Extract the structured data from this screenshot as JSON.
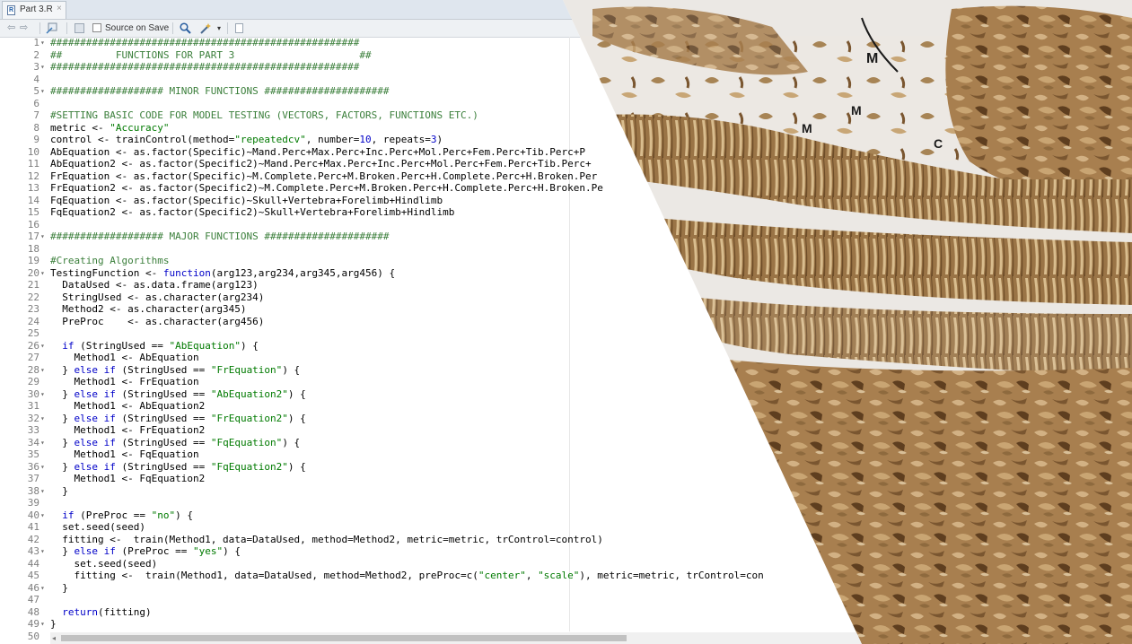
{
  "tab": {
    "icon": "R",
    "label": "Part 3.R",
    "close": "×"
  },
  "toolbar": {
    "source_on_save": "Source on Save",
    "back_arrow": "⇦",
    "forward_arrow": "⇨"
  },
  "colors": {
    "tab_bar": "#dfe6ee",
    "toolbar": "#eef1f4",
    "comment": "#3b7f3b",
    "string": "#007a00",
    "keyword": "#0000c8",
    "line_number": "#7e7e7e"
  },
  "photo": {
    "subject": "sorted bones and teeth fragments",
    "marker_letters": [
      "M",
      "M",
      "M",
      "C"
    ]
  },
  "code_lines": [
    {
      "n": "1",
      "fold": true,
      "segs": [
        {
          "t": "####################################################",
          "c": "cm"
        }
      ]
    },
    {
      "n": "2",
      "fold": false,
      "segs": [
        {
          "t": "##         FUNCTIONS FOR PART 3                     ##",
          "c": "cm"
        }
      ]
    },
    {
      "n": "3",
      "fold": true,
      "segs": [
        {
          "t": "####################################################",
          "c": "cm"
        }
      ]
    },
    {
      "n": "4",
      "fold": false,
      "segs": []
    },
    {
      "n": "5",
      "fold": true,
      "segs": [
        {
          "t": "################### MINOR FUNCTIONS #####################",
          "c": "cm"
        }
      ]
    },
    {
      "n": "6",
      "fold": false,
      "segs": []
    },
    {
      "n": "7",
      "fold": false,
      "segs": [
        {
          "t": "#SETTING BASIC CODE FOR MODEL TESTING (VECTORS, FACTORS, FUNCTIONS ETC.)",
          "c": "cm"
        }
      ]
    },
    {
      "n": "8",
      "fold": false,
      "segs": [
        {
          "t": "metric <- ",
          "c": ""
        },
        {
          "t": "\"Accuracy\"",
          "c": "st"
        }
      ]
    },
    {
      "n": "9",
      "fold": false,
      "segs": [
        {
          "t": "control <- trainControl(method=",
          "c": ""
        },
        {
          "t": "\"repeatedcv\"",
          "c": "st"
        },
        {
          "t": ", number=",
          "c": ""
        },
        {
          "t": "10",
          "c": "nm"
        },
        {
          "t": ", repeats=",
          "c": ""
        },
        {
          "t": "3",
          "c": "nm"
        },
        {
          "t": ")",
          "c": ""
        }
      ]
    },
    {
      "n": "10",
      "fold": false,
      "segs": [
        {
          "t": "AbEquation <- as.factor(Specific)~Mand.Perc+Max.Perc+Inc.Perc+Mol.Perc+Fem.Perc+Tib.Perc+P",
          "c": ""
        }
      ]
    },
    {
      "n": "11",
      "fold": false,
      "segs": [
        {
          "t": "AbEquation2 <- as.factor(Specific2)~Mand.Perc+Max.Perc+Inc.Perc+Mol.Perc+Fem.Perc+Tib.Perc+",
          "c": ""
        }
      ]
    },
    {
      "n": "12",
      "fold": false,
      "segs": [
        {
          "t": "FrEquation <- as.factor(Specific)~M.Complete.Perc+M.Broken.Perc+H.Complete.Perc+H.Broken.Per",
          "c": ""
        }
      ]
    },
    {
      "n": "13",
      "fold": false,
      "segs": [
        {
          "t": "FrEquation2 <- as.factor(Specific2)~M.Complete.Perc+M.Broken.Perc+H.Complete.Perc+H.Broken.Pe",
          "c": ""
        }
      ]
    },
    {
      "n": "14",
      "fold": false,
      "segs": [
        {
          "t": "FqEquation <- as.factor(Specific)~Skull+Vertebra+Forelimb+Hindlimb",
          "c": ""
        }
      ]
    },
    {
      "n": "15",
      "fold": false,
      "segs": [
        {
          "t": "FqEquation2 <- as.factor(Specific2)~Skull+Vertebra+Forelimb+Hindlimb",
          "c": ""
        }
      ]
    },
    {
      "n": "16",
      "fold": false,
      "segs": []
    },
    {
      "n": "17",
      "fold": true,
      "segs": [
        {
          "t": "################### MAJOR FUNCTIONS #####################",
          "c": "cm"
        }
      ]
    },
    {
      "n": "18",
      "fold": false,
      "segs": []
    },
    {
      "n": "19",
      "fold": false,
      "segs": [
        {
          "t": "#Creating Algorithms",
          "c": "cm"
        }
      ]
    },
    {
      "n": "20",
      "fold": true,
      "segs": [
        {
          "t": "TestingFunction <- ",
          "c": ""
        },
        {
          "t": "function",
          "c": "kw"
        },
        {
          "t": "(arg123,arg234,arg345,arg456) {",
          "c": ""
        }
      ]
    },
    {
      "n": "21",
      "fold": false,
      "segs": [
        {
          "t": "  DataUsed <- as.data.frame(arg123)",
          "c": ""
        }
      ]
    },
    {
      "n": "22",
      "fold": false,
      "segs": [
        {
          "t": "  StringUsed <- as.character(arg234)",
          "c": ""
        }
      ]
    },
    {
      "n": "23",
      "fold": false,
      "segs": [
        {
          "t": "  Method2 <- as.character(arg345)",
          "c": ""
        }
      ]
    },
    {
      "n": "24",
      "fold": false,
      "segs": [
        {
          "t": "  PreProc    <- as.character(arg456)",
          "c": ""
        }
      ]
    },
    {
      "n": "25",
      "fold": false,
      "segs": []
    },
    {
      "n": "26",
      "fold": true,
      "segs": [
        {
          "t": "  ",
          "c": ""
        },
        {
          "t": "if",
          "c": "kw"
        },
        {
          "t": " (StringUsed == ",
          "c": ""
        },
        {
          "t": "\"AbEquation\"",
          "c": "st"
        },
        {
          "t": ") {",
          "c": ""
        }
      ]
    },
    {
      "n": "27",
      "fold": false,
      "segs": [
        {
          "t": "    Method1 <- AbEquation",
          "c": ""
        }
      ]
    },
    {
      "n": "28",
      "fold": true,
      "segs": [
        {
          "t": "  } ",
          "c": ""
        },
        {
          "t": "else if",
          "c": "kw"
        },
        {
          "t": " (StringUsed == ",
          "c": ""
        },
        {
          "t": "\"FrEquation\"",
          "c": "st"
        },
        {
          "t": ") {",
          "c": ""
        }
      ]
    },
    {
      "n": "29",
      "fold": false,
      "segs": [
        {
          "t": "    Method1 <- FrEquation",
          "c": ""
        }
      ]
    },
    {
      "n": "30",
      "fold": true,
      "segs": [
        {
          "t": "  } ",
          "c": ""
        },
        {
          "t": "else if",
          "c": "kw"
        },
        {
          "t": " (StringUsed == ",
          "c": ""
        },
        {
          "t": "\"AbEquation2\"",
          "c": "st"
        },
        {
          "t": ") {",
          "c": ""
        }
      ]
    },
    {
      "n": "31",
      "fold": false,
      "segs": [
        {
          "t": "    Method1 <- AbEquation2",
          "c": ""
        }
      ]
    },
    {
      "n": "32",
      "fold": true,
      "segs": [
        {
          "t": "  } ",
          "c": ""
        },
        {
          "t": "else if",
          "c": "kw"
        },
        {
          "t": " (StringUsed == ",
          "c": ""
        },
        {
          "t": "\"FrEquation2\"",
          "c": "st"
        },
        {
          "t": ") {",
          "c": ""
        }
      ]
    },
    {
      "n": "33",
      "fold": false,
      "segs": [
        {
          "t": "    Method1 <- FrEquation2",
          "c": ""
        }
      ]
    },
    {
      "n": "34",
      "fold": true,
      "segs": [
        {
          "t": "  } ",
          "c": ""
        },
        {
          "t": "else if",
          "c": "kw"
        },
        {
          "t": " (StringUsed == ",
          "c": ""
        },
        {
          "t": "\"FqEquation\"",
          "c": "st"
        },
        {
          "t": ") {",
          "c": ""
        }
      ]
    },
    {
      "n": "35",
      "fold": false,
      "segs": [
        {
          "t": "    Method1 <- FqEquation",
          "c": ""
        }
      ]
    },
    {
      "n": "36",
      "fold": true,
      "segs": [
        {
          "t": "  } ",
          "c": ""
        },
        {
          "t": "else if",
          "c": "kw"
        },
        {
          "t": " (StringUsed == ",
          "c": ""
        },
        {
          "t": "\"FqEquation2\"",
          "c": "st"
        },
        {
          "t": ") {",
          "c": ""
        }
      ]
    },
    {
      "n": "37",
      "fold": false,
      "segs": [
        {
          "t": "    Method1 <- FqEquation2",
          "c": ""
        }
      ]
    },
    {
      "n": "38",
      "fold": true,
      "segs": [
        {
          "t": "  }",
          "c": ""
        }
      ]
    },
    {
      "n": "39",
      "fold": false,
      "segs": []
    },
    {
      "n": "40",
      "fold": true,
      "segs": [
        {
          "t": "  ",
          "c": ""
        },
        {
          "t": "if",
          "c": "kw"
        },
        {
          "t": " (PreProc == ",
          "c": ""
        },
        {
          "t": "\"no\"",
          "c": "st"
        },
        {
          "t": ") {",
          "c": ""
        }
      ]
    },
    {
      "n": "41",
      "fold": false,
      "segs": [
        {
          "t": "  set.seed(seed)",
          "c": ""
        }
      ]
    },
    {
      "n": "42",
      "fold": false,
      "segs": [
        {
          "t": "  fitting <-  train(Method1, data=DataUsed, method=Method2, metric=metric, trControl=control)",
          "c": ""
        }
      ]
    },
    {
      "n": "43",
      "fold": true,
      "segs": [
        {
          "t": "  } ",
          "c": ""
        },
        {
          "t": "else if",
          "c": "kw"
        },
        {
          "t": " (PreProc == ",
          "c": ""
        },
        {
          "t": "\"yes\"",
          "c": "st"
        },
        {
          "t": ") {",
          "c": ""
        }
      ]
    },
    {
      "n": "44",
      "fold": false,
      "segs": [
        {
          "t": "    set.seed(seed)",
          "c": ""
        }
      ]
    },
    {
      "n": "45",
      "fold": false,
      "segs": [
        {
          "t": "    fitting <-  train(Method1, data=DataUsed, method=Method2, preProc=c(",
          "c": ""
        },
        {
          "t": "\"center\"",
          "c": "st"
        },
        {
          "t": ", ",
          "c": ""
        },
        {
          "t": "\"scale\"",
          "c": "st"
        },
        {
          "t": "), metric=metric, trControl=con",
          "c": ""
        }
      ]
    },
    {
      "n": "46",
      "fold": true,
      "segs": [
        {
          "t": "  }",
          "c": ""
        }
      ]
    },
    {
      "n": "47",
      "fold": false,
      "segs": []
    },
    {
      "n": "48",
      "fold": false,
      "segs": [
        {
          "t": "  ",
          "c": ""
        },
        {
          "t": "return",
          "c": "kw"
        },
        {
          "t": "(fitting)",
          "c": ""
        }
      ]
    },
    {
      "n": "49",
      "fold": true,
      "segs": [
        {
          "t": "}",
          "c": ""
        }
      ]
    },
    {
      "n": "50",
      "fold": false,
      "segs": []
    }
  ]
}
